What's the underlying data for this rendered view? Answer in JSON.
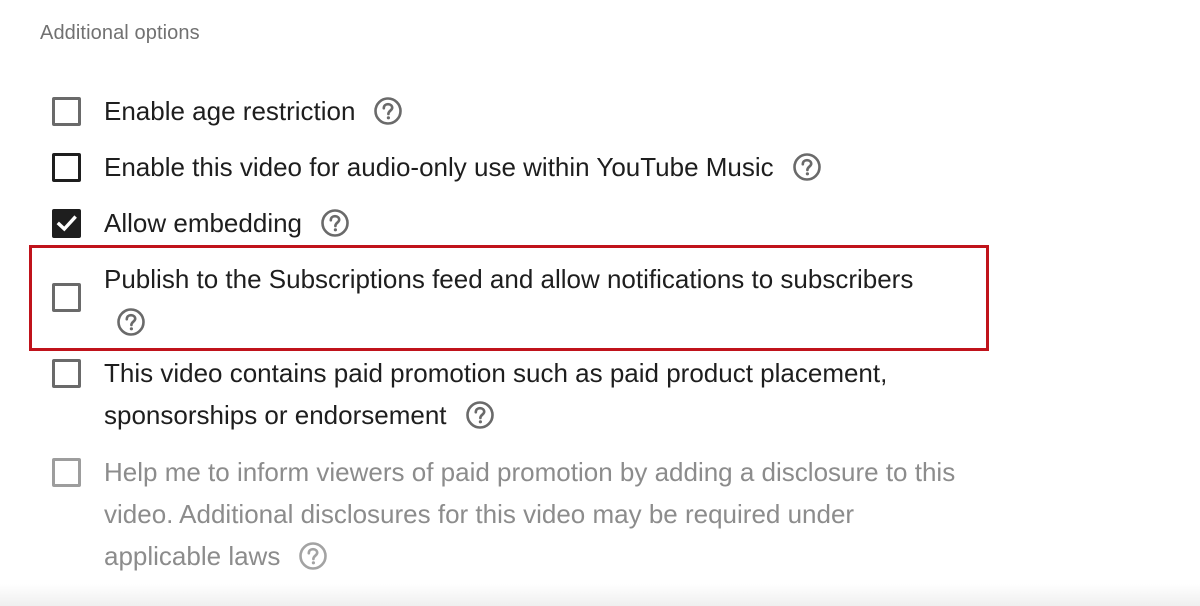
{
  "section": {
    "title": "Additional options"
  },
  "options": [
    {
      "label": "Enable age restriction",
      "checked": false,
      "disabled": false,
      "help_icon": "help-circle-icon"
    },
    {
      "label": "Enable this video for audio-only use within YouTube Music",
      "checked": false,
      "disabled": false,
      "help_icon": "help-circle-icon"
    },
    {
      "label": "Allow embedding",
      "checked": true,
      "disabled": false,
      "help_icon": "help-circle-icon"
    },
    {
      "label": "Publish to the Subscriptions feed and allow notifications to subscribers",
      "checked": false,
      "disabled": false,
      "highlighted": true,
      "help_icon": "help-circle-icon"
    },
    {
      "label_lines": [
        "This video contains paid promotion such as paid product placement,",
        "sponsorships or endorsement"
      ],
      "checked": false,
      "disabled": false,
      "help_icon": "help-circle-icon"
    },
    {
      "label_lines": [
        "Help me to inform viewers of paid promotion by adding a disclosure to this",
        "video. Additional disclosures for this video may be required under",
        "applicable laws"
      ],
      "checked": false,
      "disabled": true,
      "help_icon": "help-circle-icon"
    }
  ],
  "colors": {
    "text": "#1e1e1e",
    "muted_text": "#717171",
    "highlight_border": "#c0131b",
    "checkbox_border": "#6a6a6a"
  }
}
